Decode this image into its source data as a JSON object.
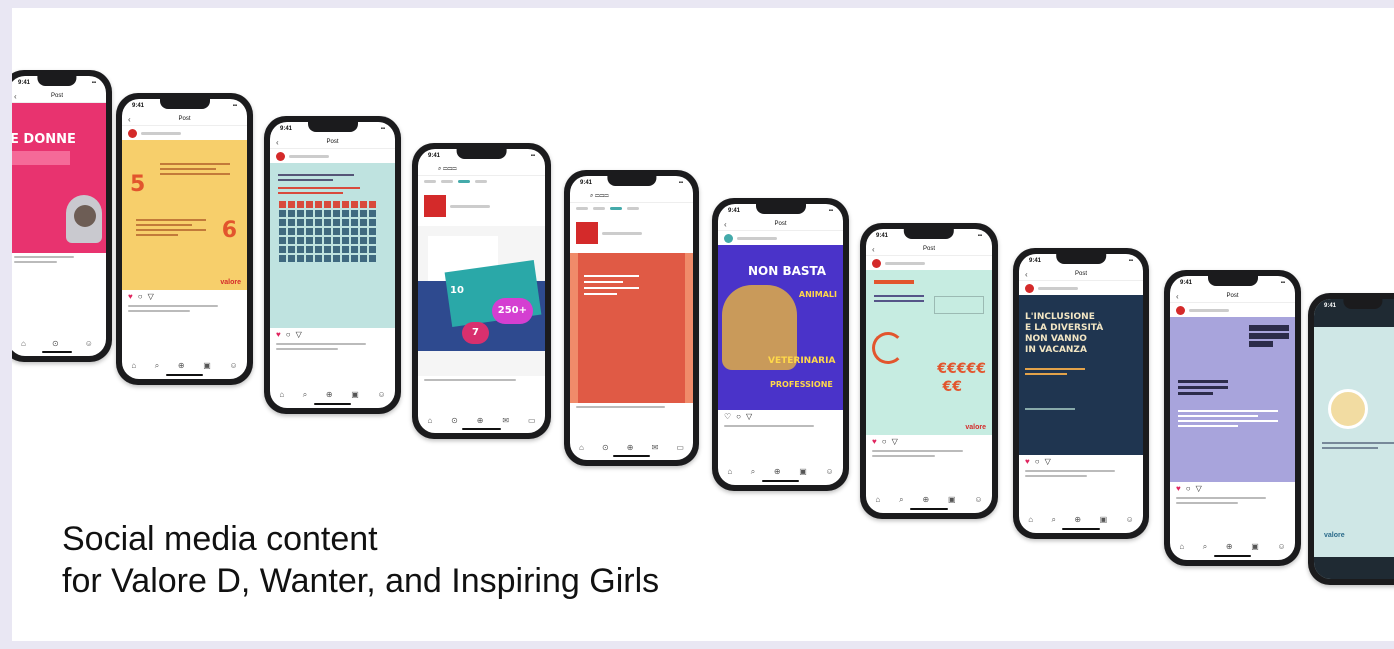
{
  "headline": {
    "line1": "Social media content",
    "line2": "for Valore D, Wanter, and Inspiring Girls"
  },
  "phones": [
    {
      "theme": "pink",
      "post_text": "E DONNE"
    },
    {
      "theme": "yellow",
      "numbers": [
        "5",
        "6"
      ]
    },
    {
      "theme": "teal-grid"
    },
    {
      "theme": "white-collage",
      "badges": [
        "10",
        "250+",
        "7"
      ]
    },
    {
      "theme": "red-orange"
    },
    {
      "theme": "purple-dog",
      "lines": [
        "NON BASTA",
        "ANIMALI",
        "VETERINARIA",
        "PROFESSIONE"
      ]
    },
    {
      "theme": "mint-euro",
      "symbols": "€€€€€"
    },
    {
      "theme": "navy-inclusion",
      "lines": [
        "L'INCLUSIONE",
        "E LA DIVERSITÀ",
        "NON VANNO",
        "IN VACANZA"
      ]
    },
    {
      "theme": "lavender"
    },
    {
      "theme": "dark-profile"
    }
  ],
  "brand_mark": "valore",
  "colors": {
    "background": "#e9e7f3",
    "pink": "#e8336f",
    "yellow": "#f7cf6b",
    "teal": "#bfe3e0",
    "red": "#e05a45",
    "purple": "#4a33c9",
    "mint": "#c6ece1",
    "navy": "#1f3550",
    "lavender": "#a8a4dc"
  }
}
